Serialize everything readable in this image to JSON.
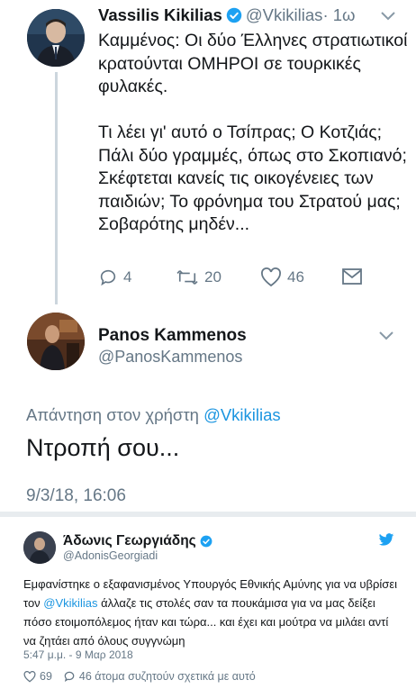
{
  "tweet1": {
    "name": "Vassilis Kikilias",
    "handle": "@Vkikilias",
    "time": "· 1ω",
    "text": "Καμμένος: Οι δύο Έλληνες στρατιωτικοί κρατούνται ΟΜΗΡΟΙ σε τουρκικές φυλακές.\n\nΤι λέει γι' αυτό ο Τσίπρας; Ο Κοτζιάς; Πάλι δύο γραμμές, όπως στο Σκοπιανό; Σκέφτεται κανείς τις οικογένειες των παιδιών; Το φρόνημα του Στρατού μας; Σοβαρότης μηδέν...",
    "replies": "4",
    "retweets": "20",
    "likes": "46"
  },
  "tweet2": {
    "name": "Panos Kammenos",
    "handle": "@PanosKammenos",
    "reply_prefix": "Απάντηση στον χρήστη ",
    "reply_mention": "@Vkikilias",
    "text": "Ντροπή σου...",
    "date": "9/3/18, 16:06"
  },
  "embed": {
    "name": "Άδωνις Γεωργιάδης",
    "handle": "@AdonisGeorgiadi",
    "text_before": "Εμφανίστηκε ο εξαφανισμένος Υπουργός Εθνικής Αμύνης για να υβρίσει τον ",
    "mention": "@Vkikilias",
    "text_after": " άλλαζε τις στολές σαν τα πουκάμισα για να μας δείξει πόσο ετοιμοπόλεμος ήταν και τώρα... και έχει και μούτρα να μιλάει αντί να ζητάει από όλους συγγνώμη",
    "timestamp": "5:47 μ.μ. - 9 Μαρ 2018",
    "likes": "69",
    "discussion": "46 άτομα συζητούν σχετικά με αυτό"
  },
  "colors": {
    "accent": "#1da1f2",
    "muted": "#657786",
    "text": "#14171a",
    "separator": "#e8ecef"
  }
}
